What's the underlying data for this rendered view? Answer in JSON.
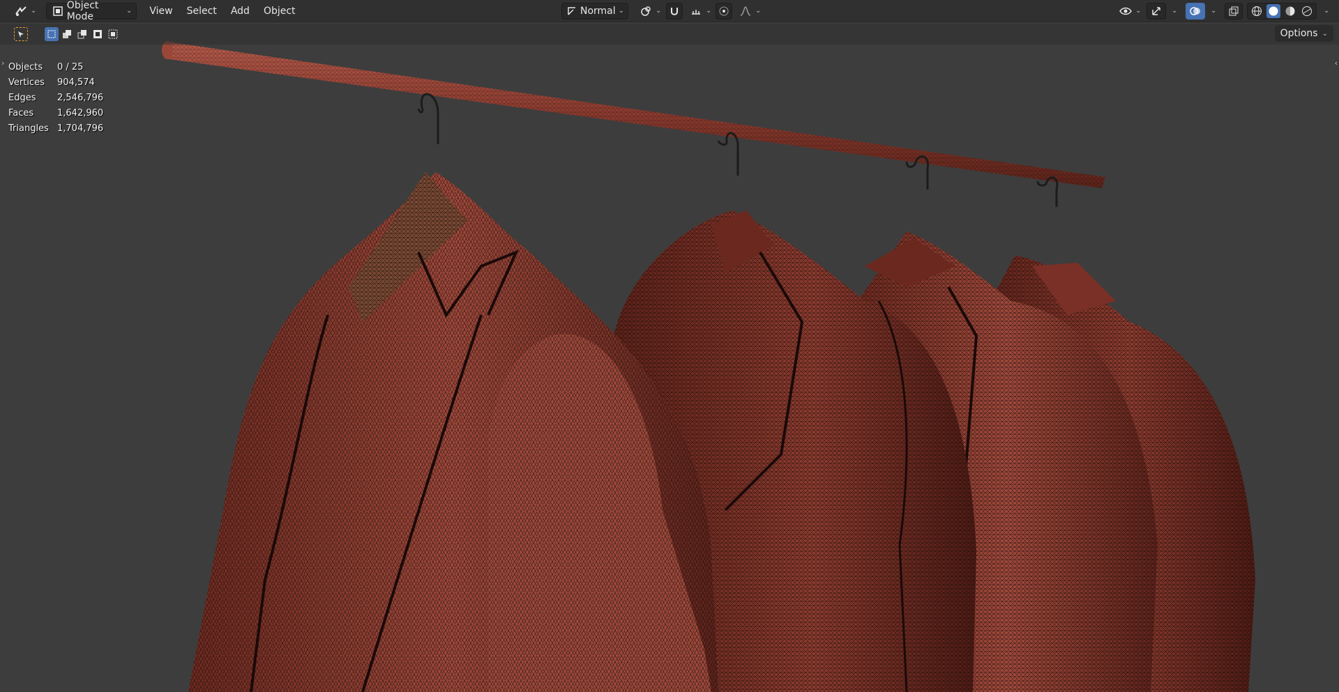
{
  "header": {
    "mode_label": "Object Mode",
    "menus": [
      "View",
      "Select",
      "Add",
      "Object"
    ],
    "orientation_label": "Normal",
    "options_label": "Options"
  },
  "stats": [
    {
      "label": "Objects",
      "value": "0 / 25"
    },
    {
      "label": "Vertices",
      "value": "904,574"
    },
    {
      "label": "Edges",
      "value": "2,546,796"
    },
    {
      "label": "Faces",
      "value": "1,642,960"
    },
    {
      "label": "Triangles",
      "value": "1,704,796"
    }
  ],
  "colors": {
    "header_bg": "#303030",
    "viewport_bg": "#3d3d3d",
    "accent_blue": "#4772b3",
    "mesh_red": "#8e3c30",
    "wire": "#1a0c0a"
  },
  "icons": {
    "editor_type": "editor-type-icon",
    "mode": "object-mode-icon",
    "transform_orientation": "transform-orientation-icon",
    "pivot": "pivot-point-icon",
    "snap": "snap-icon",
    "proportional": "proportional-editing-icon",
    "visibility": "visibility-icon",
    "gizmo": "gizmo-icon",
    "overlay": "overlay-icon",
    "xray": "xray-icon",
    "shading_wire": "wireframe-shading-icon",
    "shading_solid": "solid-shading-icon",
    "shading_material": "material-shading-icon",
    "shading_rendered": "rendered-shading-icon"
  }
}
